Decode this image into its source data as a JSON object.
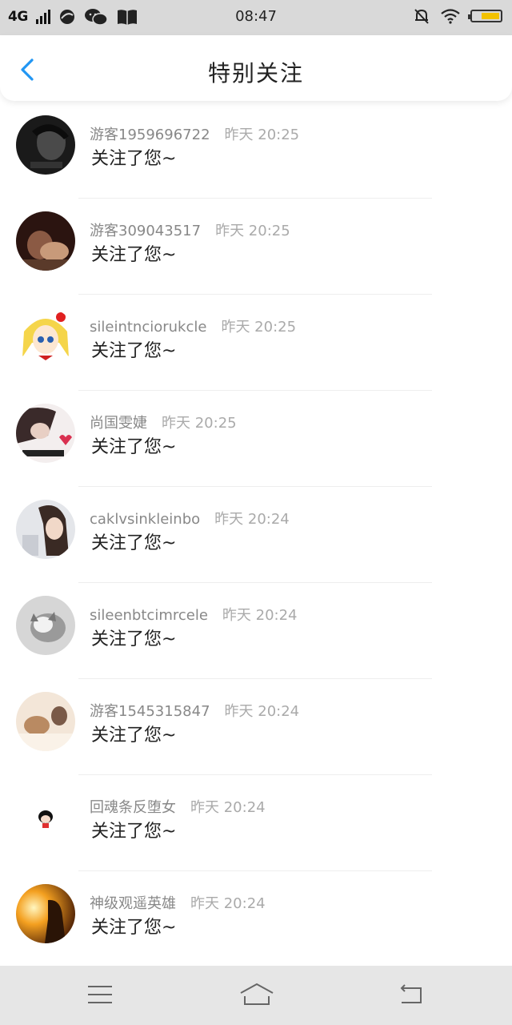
{
  "status_bar": {
    "network": "4G",
    "time": "08:47"
  },
  "header": {
    "title": "特别关注"
  },
  "accent_color": "#2196f3",
  "items": [
    {
      "name": "游客1959696722",
      "time": "昨天 20:25",
      "message": "关注了您~"
    },
    {
      "name": "游客309043517",
      "time": "昨天 20:25",
      "message": "关注了您~"
    },
    {
      "name": "sileintnciorukcle",
      "time": "昨天 20:25",
      "message": "关注了您~"
    },
    {
      "name": "尚国雯婕",
      "time": "昨天 20:25",
      "message": "关注了您~"
    },
    {
      "name": "caklvsinkleinbo",
      "time": "昨天 20:24",
      "message": "关注了您~"
    },
    {
      "name": "sileenbtcimrcele",
      "time": "昨天 20:24",
      "message": "关注了您~"
    },
    {
      "name": "游客1545315847",
      "time": "昨天 20:24",
      "message": "关注了您~"
    },
    {
      "name": "回魂条反堕女",
      "time": "昨天 20:24",
      "message": "关注了您~"
    },
    {
      "name": "神级观遥英雄",
      "time": "昨天 20:24",
      "message": "关注了您~"
    }
  ]
}
